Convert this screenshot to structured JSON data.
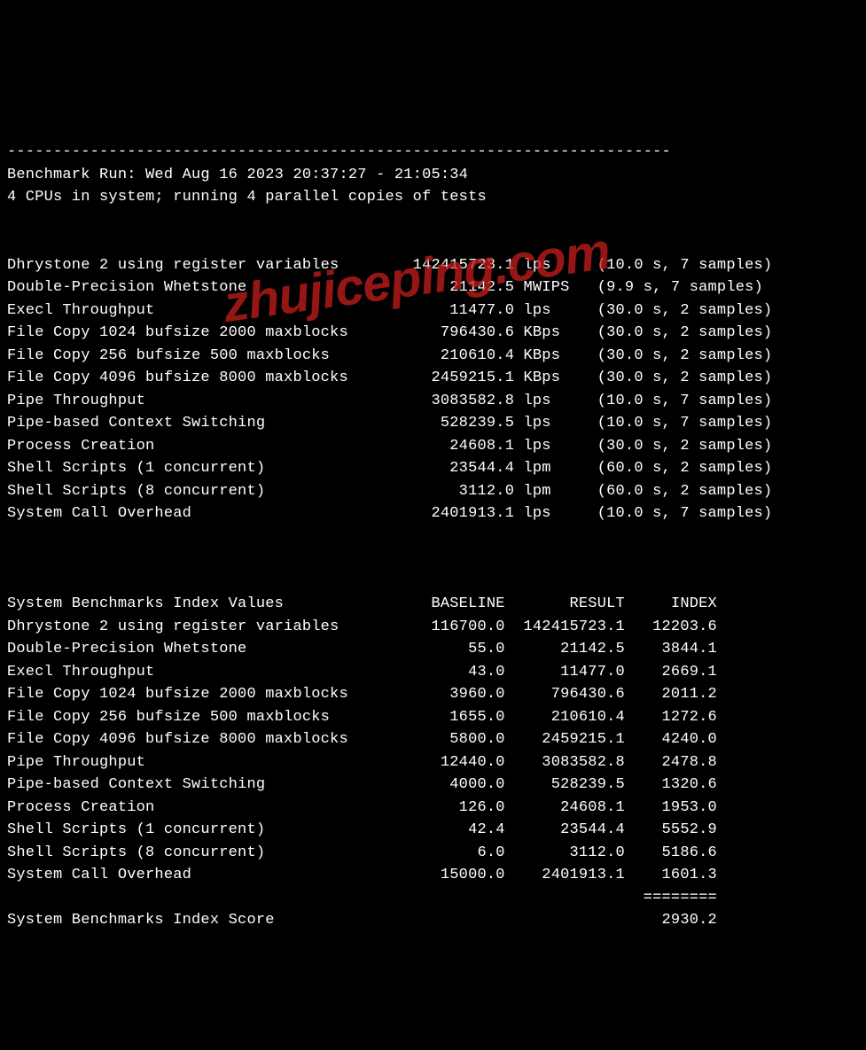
{
  "watermark": "zhujiceping.com",
  "divider_top": "------------------------------------------------------------------------",
  "run_line": "Benchmark Run: Wed Aug 16 2023 20:37:27 - 21:05:34",
  "cpu_line": "4 CPUs in system; running 4 parallel copies of tests",
  "raw": {
    "cols": {
      "name_w": 41,
      "val_w": 14,
      "unit_w": 5,
      "note_gap": 3
    },
    "rows": [
      {
        "name": "Dhrystone 2 using register variables",
        "value": "142415723.1",
        "unit": "lps",
        "note": "(10.0 s, 7 samples)"
      },
      {
        "name": "Double-Precision Whetstone",
        "value": "21142.5",
        "unit": "MWIPS",
        "note": "(9.9 s, 7 samples)"
      },
      {
        "name": "Execl Throughput",
        "value": "11477.0",
        "unit": "lps",
        "note": "(30.0 s, 2 samples)"
      },
      {
        "name": "File Copy 1024 bufsize 2000 maxblocks",
        "value": "796430.6",
        "unit": "KBps",
        "note": "(30.0 s, 2 samples)"
      },
      {
        "name": "File Copy 256 bufsize 500 maxblocks",
        "value": "210610.4",
        "unit": "KBps",
        "note": "(30.0 s, 2 samples)"
      },
      {
        "name": "File Copy 4096 bufsize 8000 maxblocks",
        "value": "2459215.1",
        "unit": "KBps",
        "note": "(30.0 s, 2 samples)"
      },
      {
        "name": "Pipe Throughput",
        "value": "3083582.8",
        "unit": "lps",
        "note": "(10.0 s, 7 samples)"
      },
      {
        "name": "Pipe-based Context Switching",
        "value": "528239.5",
        "unit": "lps",
        "note": "(10.0 s, 7 samples)"
      },
      {
        "name": "Process Creation",
        "value": "24608.1",
        "unit": "lps",
        "note": "(30.0 s, 2 samples)"
      },
      {
        "name": "Shell Scripts (1 concurrent)",
        "value": "23544.4",
        "unit": "lpm",
        "note": "(60.0 s, 2 samples)"
      },
      {
        "name": "Shell Scripts (8 concurrent)",
        "value": "3112.0",
        "unit": "lpm",
        "note": "(60.0 s, 2 samples)"
      },
      {
        "name": "System Call Overhead",
        "value": "2401913.1",
        "unit": "lps",
        "note": "(10.0 s, 7 samples)"
      }
    ]
  },
  "index": {
    "header": {
      "title": "System Benchmarks Index Values",
      "c1": "BASELINE",
      "c2": "RESULT",
      "c3": "INDEX"
    },
    "cols": {
      "name_w": 41,
      "c1_w": 13,
      "c2_w": 13,
      "c3_w": 10
    },
    "rows": [
      {
        "name": "Dhrystone 2 using register variables",
        "baseline": "116700.0",
        "result": "142415723.1",
        "index": "12203.6"
      },
      {
        "name": "Double-Precision Whetstone",
        "baseline": "55.0",
        "result": "21142.5",
        "index": "3844.1"
      },
      {
        "name": "Execl Throughput",
        "baseline": "43.0",
        "result": "11477.0",
        "index": "2669.1"
      },
      {
        "name": "File Copy 1024 bufsize 2000 maxblocks",
        "baseline": "3960.0",
        "result": "796430.6",
        "index": "2011.2"
      },
      {
        "name": "File Copy 256 bufsize 500 maxblocks",
        "baseline": "1655.0",
        "result": "210610.4",
        "index": "1272.6"
      },
      {
        "name": "File Copy 4096 bufsize 8000 maxblocks",
        "baseline": "5800.0",
        "result": "2459215.1",
        "index": "4240.0"
      },
      {
        "name": "Pipe Throughput",
        "baseline": "12440.0",
        "result": "3083582.8",
        "index": "2478.8"
      },
      {
        "name": "Pipe-based Context Switching",
        "baseline": "4000.0",
        "result": "528239.5",
        "index": "1320.6"
      },
      {
        "name": "Process Creation",
        "baseline": "126.0",
        "result": "24608.1",
        "index": "1953.0"
      },
      {
        "name": "Shell Scripts (1 concurrent)",
        "baseline": "42.4",
        "result": "23544.4",
        "index": "5552.9"
      },
      {
        "name": "Shell Scripts (8 concurrent)",
        "baseline": "6.0",
        "result": "3112.0",
        "index": "5186.6"
      },
      {
        "name": "System Call Overhead",
        "baseline": "15000.0",
        "result": "2401913.1",
        "index": "1601.3"
      }
    ],
    "rule": "========",
    "score_label": "System Benchmarks Index Score",
    "score_value": "2930.2"
  }
}
